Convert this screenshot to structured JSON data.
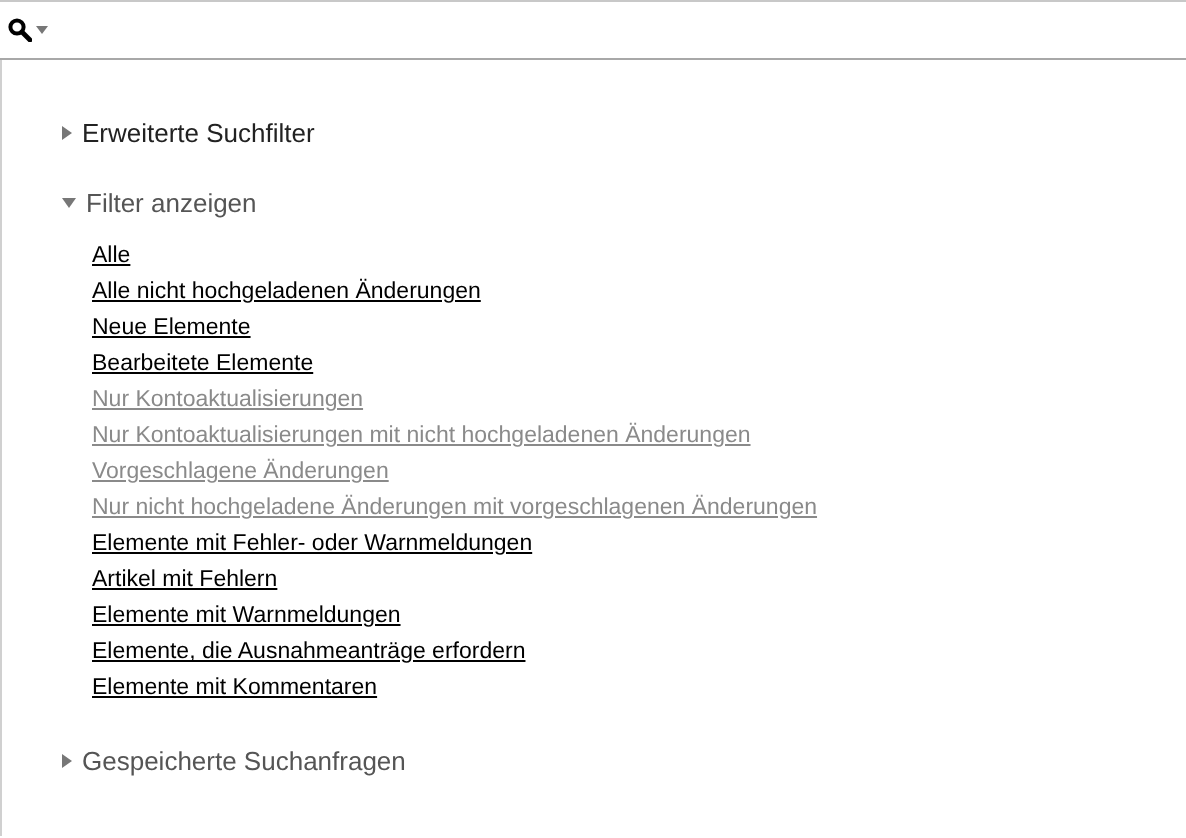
{
  "sections": [
    {
      "title": "Erweiterte Suchfilter",
      "expanded": false
    },
    {
      "title": "Filter anzeigen",
      "expanded": true,
      "links": [
        {
          "label": "Alle",
          "disabled": false
        },
        {
          "label": "Alle nicht hochgeladenen Änderungen",
          "disabled": false
        },
        {
          "label": "Neue Elemente",
          "disabled": false
        },
        {
          "label": "Bearbeitete Elemente",
          "disabled": false
        },
        {
          "label": "Nur Kontoaktualisierungen",
          "disabled": true
        },
        {
          "label": "Nur Kontoaktualisierungen mit nicht hochgeladenen Änderungen",
          "disabled": true
        },
        {
          "label": "Vorgeschlagene Änderungen",
          "disabled": true
        },
        {
          "label": "Nur nicht hochgeladene Änderungen mit vorgeschlagenen Änderungen",
          "disabled": true
        },
        {
          "label": "Elemente mit Fehler- oder Warnmeldungen",
          "disabled": false
        },
        {
          "label": "Artikel mit Fehlern",
          "disabled": false
        },
        {
          "label": "Elemente mit Warnmeldungen",
          "disabled": false
        },
        {
          "label": "Elemente, die Ausnahmeanträge erfordern",
          "disabled": false
        },
        {
          "label": "Elemente mit Kommentaren",
          "disabled": false
        }
      ]
    },
    {
      "title": "Gespeicherte Suchanfragen",
      "expanded": false
    }
  ]
}
